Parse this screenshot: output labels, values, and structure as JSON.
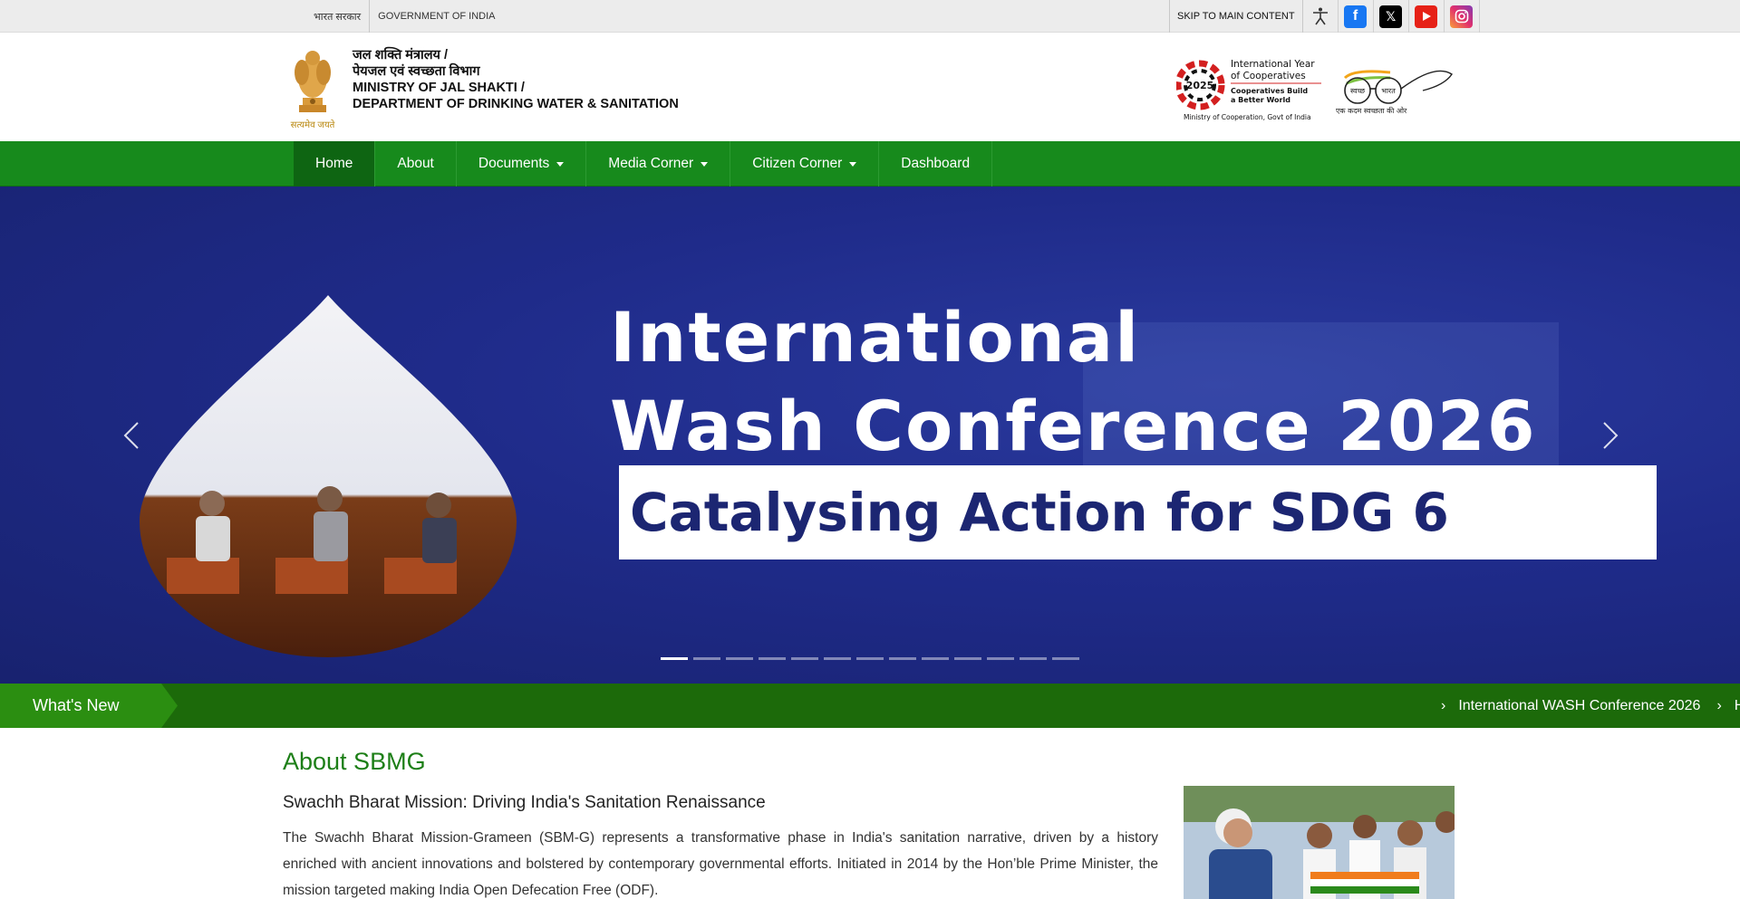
{
  "topbar": {
    "hindi_gov": "भारत सरकार",
    "gov": "GOVERNMENT OF INDIA",
    "skip": "SKIP TO MAIN CONTENT",
    "icons": [
      "accessibility-icon",
      "facebook-icon",
      "x-twitter-icon",
      "youtube-icon",
      "instagram-icon"
    ]
  },
  "header": {
    "emblem_caption": "सत्यमेव जयते",
    "ministry_lines": [
      "जल शक्ति मंत्रालय /",
      "पेयजल एवं स्वच्छता विभाग",
      "MINISTRY OF JAL SHAKTI /",
      "DEPARTMENT OF DRINKING WATER & SANITATION"
    ],
    "iyc": {
      "year": "2025",
      "title1": "International Year",
      "title2": "of Cooperatives",
      "tag1": "Cooperatives Build",
      "tag2": "a Better World",
      "footer": "Ministry of Cooperation, Govt of India"
    },
    "sbm": {
      "left": "स्वच्छ",
      "right": "भारत",
      "tagline": "एक कदम स्वच्छता की ओर"
    }
  },
  "nav": {
    "items": [
      {
        "label": "Home",
        "active": true,
        "dropdown": false
      },
      {
        "label": "About",
        "active": false,
        "dropdown": false
      },
      {
        "label": "Documents",
        "active": false,
        "dropdown": true
      },
      {
        "label": "Media Corner",
        "active": false,
        "dropdown": true
      },
      {
        "label": "Citizen Corner",
        "active": false,
        "dropdown": true
      },
      {
        "label": "Dashboard",
        "active": false,
        "dropdown": false
      }
    ]
  },
  "banner": {
    "title_line1": "International",
    "title_line2": "Wash Conference 2026",
    "subtitle": "Catalysing Action for SDG 6",
    "slide_count": 13,
    "active_slide": 0
  },
  "whats_new": {
    "label": "What's New",
    "ticker": [
      "International WASH Conference 2026",
      "H"
    ]
  },
  "about": {
    "heading": "About SBMG",
    "subheading": "Swachh Bharat Mission: Driving India's Sanitation Renaissance",
    "body": "The Swachh Bharat Mission-Grameen (SBM-G) represents a transformative phase in India's sanitation narrative, driven by a history enriched with ancient innovations and bolstered by contemporary governmental efforts. Initiated in 2014 by the Hon’ble Prime Minister, the mission targeted making India Open Defecation Free (ODF)."
  }
}
